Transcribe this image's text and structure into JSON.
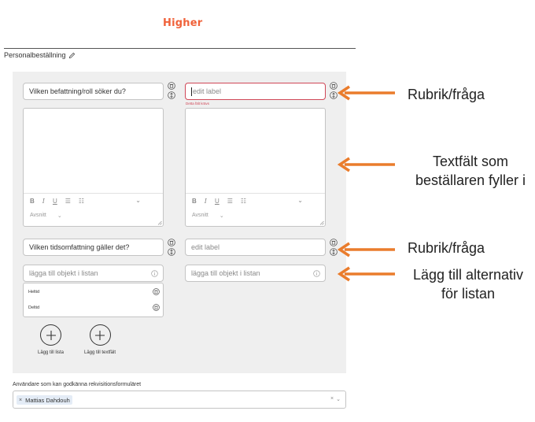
{
  "header": {
    "logo": "Higher",
    "breadcrumb": "Personalbeställning"
  },
  "form": {
    "row1": {
      "question": "Vilken befattning/roll söker du?",
      "label_placeholder": "edit label",
      "error": "Detta fält krävs"
    },
    "editor": {
      "bold": "B",
      "italic": "I",
      "underline": "U",
      "ordered_list": "☰",
      "bullet_list": "☷",
      "chevron": "⌄",
      "paragraph": "Avsnitt",
      "paragraph_chevron": "⌄"
    },
    "row2": {
      "question": "Vilken tidsomfattning gäller det?",
      "label_placeholder": "edit label"
    },
    "list_input_placeholder": "lägga till objekt i listan",
    "list_items": [
      "Heltid",
      "Deltid"
    ],
    "add_list": "Lägg till lista",
    "add_textfield": "Lägg till textfält"
  },
  "approvers": {
    "label": "Användare som kan godkänna rekvisitionsformuläret",
    "selected": "Mattias Dahdouh",
    "tag_remove": "×",
    "clear": "×",
    "dropdown": "⌄"
  },
  "annotations": {
    "heading_question": "Rubrik/fråga",
    "textfield_line1": "Textfält som",
    "textfield_line2": "beställaren fyller i",
    "heading_question_2": "Rubrik/fråga",
    "list_line1": "Lägg till alternativ",
    "list_line2": "för listan"
  },
  "colors": {
    "brand": "#f0623a",
    "arrow": "#ea7c2c",
    "error": "#d04757",
    "panel": "#efefef"
  }
}
